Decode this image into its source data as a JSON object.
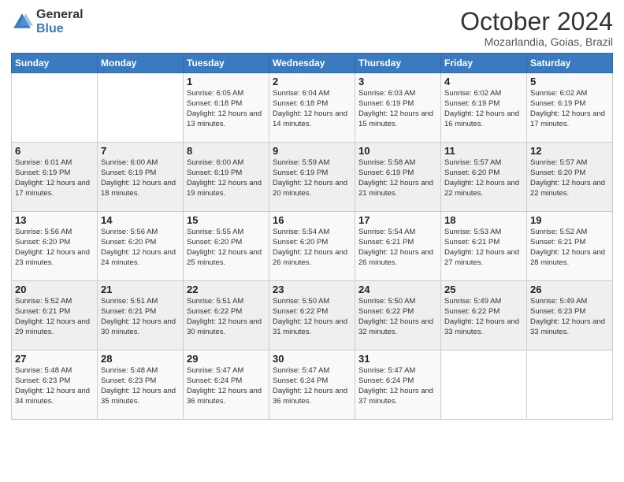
{
  "logo": {
    "general": "General",
    "blue": "Blue"
  },
  "header": {
    "month": "October 2024",
    "location": "Mozarlandia, Goias, Brazil"
  },
  "weekdays": [
    "Sunday",
    "Monday",
    "Tuesday",
    "Wednesday",
    "Thursday",
    "Friday",
    "Saturday"
  ],
  "weeks": [
    [
      {
        "day": "",
        "text": ""
      },
      {
        "day": "",
        "text": ""
      },
      {
        "day": "1",
        "text": "Sunrise: 6:05 AM\nSunset: 6:18 PM\nDaylight: 12 hours and 13 minutes."
      },
      {
        "day": "2",
        "text": "Sunrise: 6:04 AM\nSunset: 6:18 PM\nDaylight: 12 hours and 14 minutes."
      },
      {
        "day": "3",
        "text": "Sunrise: 6:03 AM\nSunset: 6:19 PM\nDaylight: 12 hours and 15 minutes."
      },
      {
        "day": "4",
        "text": "Sunrise: 6:02 AM\nSunset: 6:19 PM\nDaylight: 12 hours and 16 minutes."
      },
      {
        "day": "5",
        "text": "Sunrise: 6:02 AM\nSunset: 6:19 PM\nDaylight: 12 hours and 17 minutes."
      }
    ],
    [
      {
        "day": "6",
        "text": "Sunrise: 6:01 AM\nSunset: 6:19 PM\nDaylight: 12 hours and 17 minutes."
      },
      {
        "day": "7",
        "text": "Sunrise: 6:00 AM\nSunset: 6:19 PM\nDaylight: 12 hours and 18 minutes."
      },
      {
        "day": "8",
        "text": "Sunrise: 6:00 AM\nSunset: 6:19 PM\nDaylight: 12 hours and 19 minutes."
      },
      {
        "day": "9",
        "text": "Sunrise: 5:59 AM\nSunset: 6:19 PM\nDaylight: 12 hours and 20 minutes."
      },
      {
        "day": "10",
        "text": "Sunrise: 5:58 AM\nSunset: 6:19 PM\nDaylight: 12 hours and 21 minutes."
      },
      {
        "day": "11",
        "text": "Sunrise: 5:57 AM\nSunset: 6:20 PM\nDaylight: 12 hours and 22 minutes."
      },
      {
        "day": "12",
        "text": "Sunrise: 5:57 AM\nSunset: 6:20 PM\nDaylight: 12 hours and 22 minutes."
      }
    ],
    [
      {
        "day": "13",
        "text": "Sunrise: 5:56 AM\nSunset: 6:20 PM\nDaylight: 12 hours and 23 minutes."
      },
      {
        "day": "14",
        "text": "Sunrise: 5:56 AM\nSunset: 6:20 PM\nDaylight: 12 hours and 24 minutes."
      },
      {
        "day": "15",
        "text": "Sunrise: 5:55 AM\nSunset: 6:20 PM\nDaylight: 12 hours and 25 minutes."
      },
      {
        "day": "16",
        "text": "Sunrise: 5:54 AM\nSunset: 6:20 PM\nDaylight: 12 hours and 26 minutes."
      },
      {
        "day": "17",
        "text": "Sunrise: 5:54 AM\nSunset: 6:21 PM\nDaylight: 12 hours and 26 minutes."
      },
      {
        "day": "18",
        "text": "Sunrise: 5:53 AM\nSunset: 6:21 PM\nDaylight: 12 hours and 27 minutes."
      },
      {
        "day": "19",
        "text": "Sunrise: 5:52 AM\nSunset: 6:21 PM\nDaylight: 12 hours and 28 minutes."
      }
    ],
    [
      {
        "day": "20",
        "text": "Sunrise: 5:52 AM\nSunset: 6:21 PM\nDaylight: 12 hours and 29 minutes."
      },
      {
        "day": "21",
        "text": "Sunrise: 5:51 AM\nSunset: 6:21 PM\nDaylight: 12 hours and 30 minutes."
      },
      {
        "day": "22",
        "text": "Sunrise: 5:51 AM\nSunset: 6:22 PM\nDaylight: 12 hours and 30 minutes."
      },
      {
        "day": "23",
        "text": "Sunrise: 5:50 AM\nSunset: 6:22 PM\nDaylight: 12 hours and 31 minutes."
      },
      {
        "day": "24",
        "text": "Sunrise: 5:50 AM\nSunset: 6:22 PM\nDaylight: 12 hours and 32 minutes."
      },
      {
        "day": "25",
        "text": "Sunrise: 5:49 AM\nSunset: 6:22 PM\nDaylight: 12 hours and 33 minutes."
      },
      {
        "day": "26",
        "text": "Sunrise: 5:49 AM\nSunset: 6:23 PM\nDaylight: 12 hours and 33 minutes."
      }
    ],
    [
      {
        "day": "27",
        "text": "Sunrise: 5:48 AM\nSunset: 6:23 PM\nDaylight: 12 hours and 34 minutes."
      },
      {
        "day": "28",
        "text": "Sunrise: 5:48 AM\nSunset: 6:23 PM\nDaylight: 12 hours and 35 minutes."
      },
      {
        "day": "29",
        "text": "Sunrise: 5:47 AM\nSunset: 6:24 PM\nDaylight: 12 hours and 36 minutes."
      },
      {
        "day": "30",
        "text": "Sunrise: 5:47 AM\nSunset: 6:24 PM\nDaylight: 12 hours and 36 minutes."
      },
      {
        "day": "31",
        "text": "Sunrise: 5:47 AM\nSunset: 6:24 PM\nDaylight: 12 hours and 37 minutes."
      },
      {
        "day": "",
        "text": ""
      },
      {
        "day": "",
        "text": ""
      }
    ]
  ]
}
